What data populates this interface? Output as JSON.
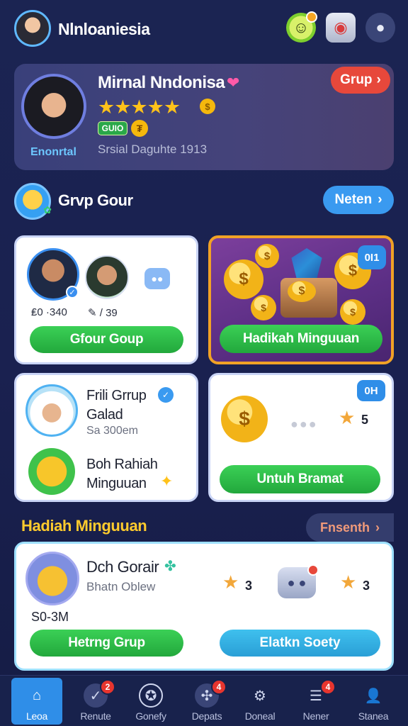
{
  "app": {
    "title": "Nlnloaniesia"
  },
  "profile": {
    "name": "Mirnal Nndonisa",
    "role": "Enonrtal",
    "level_badge": "GUIO",
    "subtitle": "Srsial Daguhte 1913",
    "stars": "★★★★★",
    "group_button": "Grup"
  },
  "group_section": {
    "title": "Grvp Gour",
    "next_button": "Neten"
  },
  "cards": {
    "group_card": {
      "stat1": "₤0 ·340",
      "stat2": "✎ / 39",
      "button": "Gfour Goup"
    },
    "weekly_gift_card": {
      "badge": "0I1",
      "button": "Hadikah Minguuan"
    },
    "member_card": {
      "name": "Frili Grrup Galad",
      "subtitle": "Sa 300em",
      "reward": "Boh Rahiah Minguuan"
    },
    "coin_card": {
      "badge": "0H",
      "star_value": "5",
      "button": "Untuh Bramat"
    }
  },
  "weekly_reward": {
    "title": "Hadiah Minguuan",
    "present_button": "Fnsenth",
    "card": {
      "name": "Dch Gorair",
      "subtitle": "Bhatn Oblew",
      "value": "S0-3M",
      "star1_value": "3",
      "star2_value": "3",
      "button_left": "Hetrng Grup",
      "button_right": "Elatkn Soety"
    }
  },
  "nav": [
    {
      "label": "Leoa",
      "icon": "home-icon",
      "badge": ""
    },
    {
      "label": "Renute",
      "icon": "route-icon",
      "badge": "2"
    },
    {
      "label": "Gonefy",
      "icon": "compass-icon",
      "badge": ""
    },
    {
      "label": "Depats",
      "icon": "deposit-icon",
      "badge": "4"
    },
    {
      "label": "Doneal",
      "icon": "gear-icon",
      "badge": ""
    },
    {
      "label": "Nener",
      "icon": "news-icon",
      "badge": "4"
    },
    {
      "label": "Stanea",
      "icon": "profile-icon",
      "badge": ""
    }
  ],
  "colors": {
    "background": "#1b2452",
    "accent_blue": "#2f8ee8",
    "accent_green": "#2bb84a",
    "accent_red": "#e7483b",
    "gold": "#ffcb2d"
  }
}
